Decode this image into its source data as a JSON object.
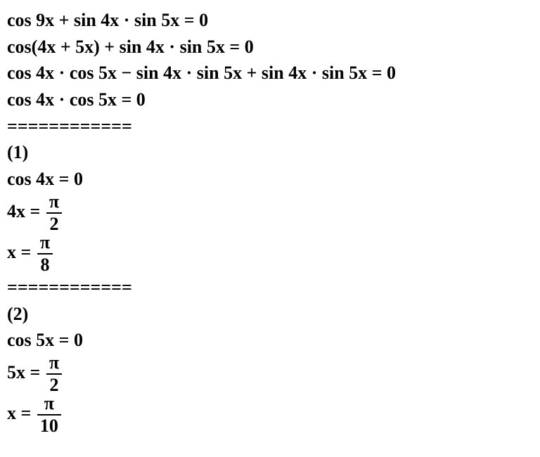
{
  "lines": {
    "l1": "cos 9x + sin 4x · sin 5x = 0",
    "l2": "cos(4x + 5x) + sin 4x · sin 5x = 0",
    "l3": "cos 4x · cos 5x − sin 4x · sin 5x + sin 4x · sin 5x = 0",
    "l4": "cos 4x · cos 5x = 0",
    "div1": "============",
    "case1_label": "(1)",
    "case1_eq": "cos 4x = 0",
    "case1_step_lhs": "4x =",
    "case1_step_num": "π",
    "case1_step_den": "2",
    "case1_sol_lhs": "x =",
    "case1_sol_num": "π",
    "case1_sol_den": "8",
    "div2": "============",
    "case2_label": "(2)",
    "case2_eq": "cos 5x = 0",
    "case2_step_lhs": "5x =",
    "case2_step_num": "π",
    "case2_step_den": "2",
    "case2_sol_lhs": "x =",
    "case2_sol_num": "π",
    "case2_sol_den": "10"
  }
}
